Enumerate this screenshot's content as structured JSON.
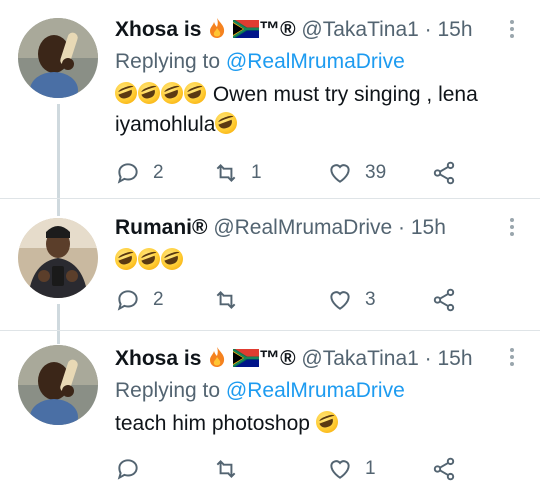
{
  "tweets": [
    {
      "name": "Xhosa is",
      "badges": "™®",
      "handle": "@TakaTina1",
      "time": "· 15h",
      "reply_prefix": "Replying to",
      "reply_to": "@RealMrumaDrive",
      "leading_emoji_count": 4,
      "text": "Owen must try singing , lena iyamohlula",
      "trailing_emoji_count": 1,
      "counts": {
        "reply": "2",
        "retweet": "1",
        "like": "39"
      }
    },
    {
      "name": "Rumani®",
      "handle": "@RealMrumaDrive",
      "time": "· 15h",
      "leading_emoji_count": 3,
      "text": "",
      "counts": {
        "reply": "2",
        "retweet": "",
        "like": "3"
      }
    },
    {
      "name": "Xhosa is",
      "badges": "™®",
      "handle": "@TakaTina1",
      "time": "· 15h",
      "reply_prefix": "Replying to",
      "reply_to": "@RealMrumaDrive",
      "text": "teach him photoshop",
      "trailing_emoji_count": 1,
      "counts": {
        "reply": "",
        "retweet": "",
        "like": "1"
      }
    }
  ],
  "icons": {
    "reply": "reply-icon",
    "retweet": "retweet-icon",
    "like": "heart-icon",
    "share": "share-icon",
    "more": "more-vertical-icon",
    "emoji": "rolling-laughing-emoji"
  },
  "colors": {
    "link": "#1d9bf0",
    "secondary": "#536471",
    "thread_line": "#cfd9de"
  }
}
